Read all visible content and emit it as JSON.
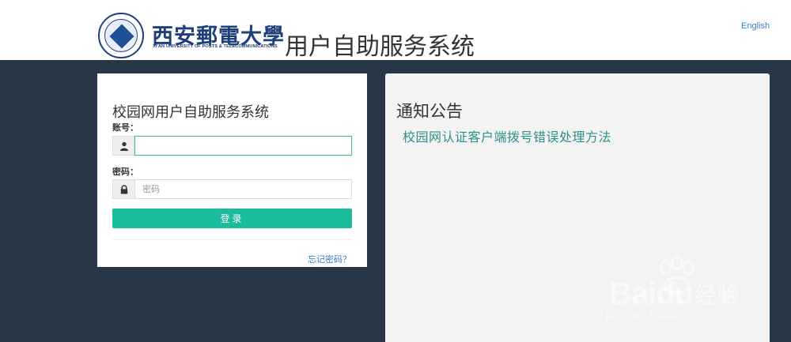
{
  "header": {
    "school_name_cn": "西安郵電大學",
    "school_name_en": "XI'AN UNIVERSITY OF POSTS & TELECOMMUNICATIONS",
    "system_title": "用户自助服务系统",
    "language_link": "English"
  },
  "login": {
    "title": "校园网用户自助服务系统",
    "account_label": "账号：",
    "account_value": "",
    "password_label": "密码：",
    "password_placeholder": "密码",
    "submit_label": "登录",
    "forgot_link": "忘记密码？"
  },
  "notice": {
    "title": "通知公告",
    "items": [
      {
        "label": "校园网认证客户端拨号错误处理方法"
      }
    ]
  },
  "watermark": {
    "brand": "Baidu",
    "suffix": "经验",
    "url": "jingyan.baidu.com"
  },
  "colors": {
    "background": "#283747",
    "accent": "#1abc9c",
    "link": "#3a7bc8",
    "notice_link": "#2e8f8a",
    "school_blue": "#1f3f7a"
  },
  "icons": {
    "account": "user-icon",
    "password": "lock-icon"
  }
}
